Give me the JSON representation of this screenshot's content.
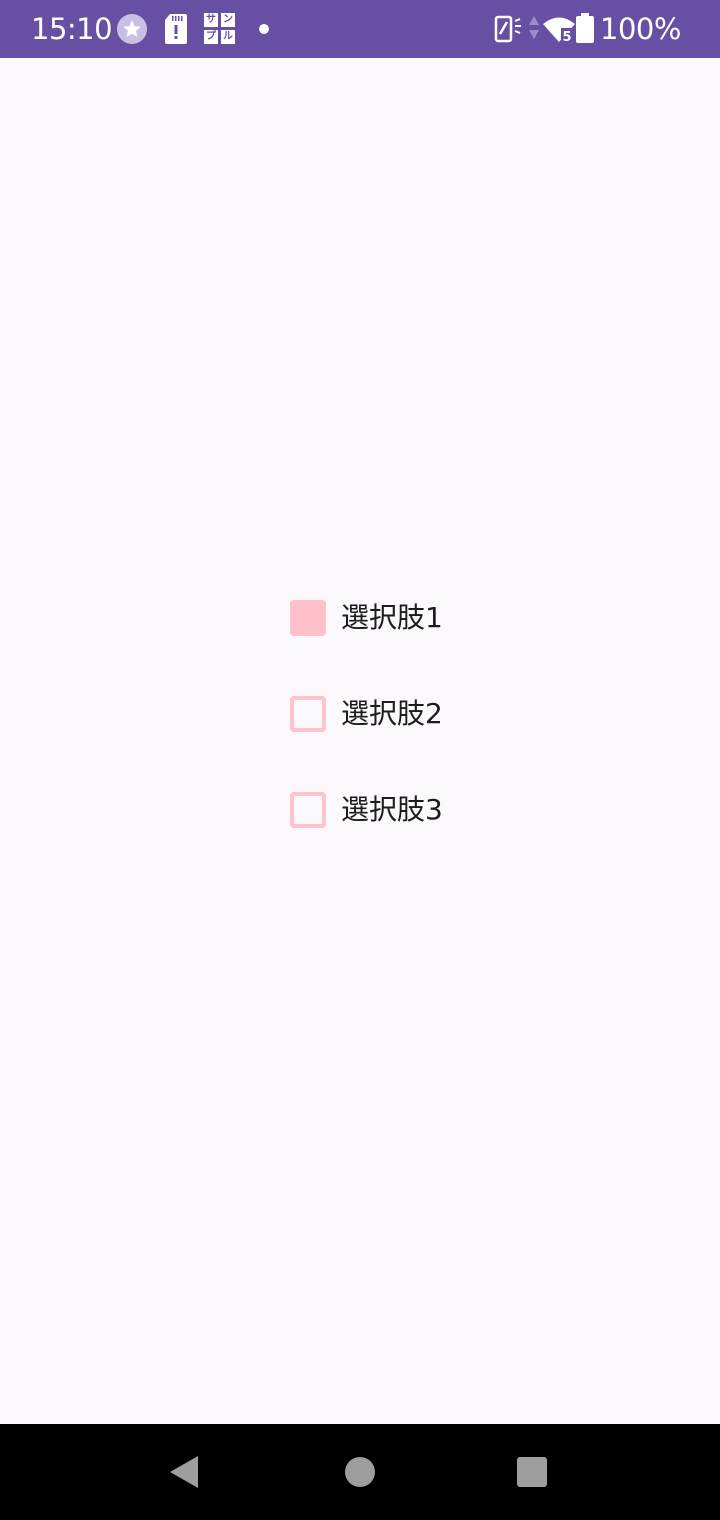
{
  "status_bar": {
    "time": "15:10",
    "sample_label": [
      "サ",
      "ン",
      "プ",
      "ル"
    ],
    "battery_percent": "100%",
    "network_badge": "5",
    "icons": [
      "star-icon",
      "sd-card-alert-icon",
      "sample-icon",
      "dot-icon",
      "vibrate-icon",
      "data-arrows-icon",
      "wifi-icon",
      "battery-icon"
    ],
    "color": "#6750a4"
  },
  "options": [
    {
      "label": "選択肢1",
      "checked": true
    },
    {
      "label": "選択肢2",
      "checked": false
    },
    {
      "label": "選択肢3",
      "checked": false
    }
  ],
  "colors": {
    "background": "#fdf8fc",
    "checkbox_checked": "#ffc0cc",
    "checkbox_border": "#ffc2cf",
    "nav_bar": "#000000",
    "nav_icon": "#9e9e9e"
  },
  "nav_bar": {
    "buttons": [
      "back-icon",
      "home-icon",
      "recents-icon"
    ]
  }
}
